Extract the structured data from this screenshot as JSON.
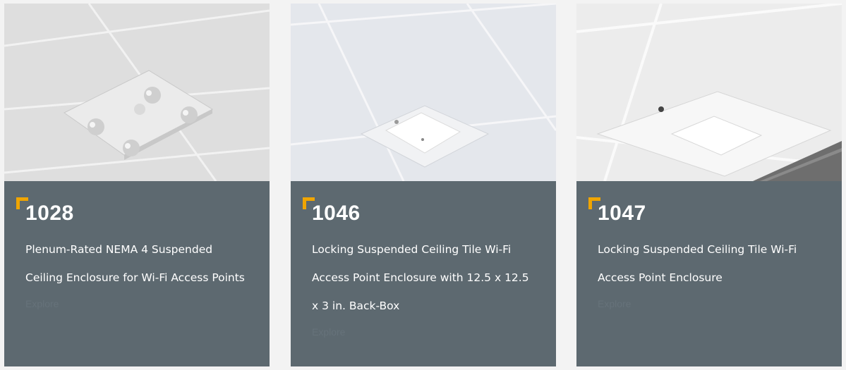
{
  "products": [
    {
      "model": "1028",
      "description": "Plenum-Rated NEMA 4 Suspended Ceiling Enclosure for Wi-Fi Access Points",
      "link_label": "Explore",
      "image_icon": "ceiling-enclosure-photo"
    },
    {
      "model": "1046",
      "description": "Locking Suspended Ceiling Tile Wi-Fi Access Point Enclosure with 12.5 x 12.5 x 3 in. Back-Box",
      "link_label": "Explore",
      "image_icon": "ceiling-enclosure-photo"
    },
    {
      "model": "1047",
      "description": "Locking Suspended Ceiling Tile Wi-Fi Access Point Enclosure",
      "link_label": "Explore",
      "image_icon": "ceiling-enclosure-photo"
    }
  ],
  "colors": {
    "card_background": "#5d6970",
    "accent": "#f0a500",
    "page_background": "#f3f3f3"
  }
}
